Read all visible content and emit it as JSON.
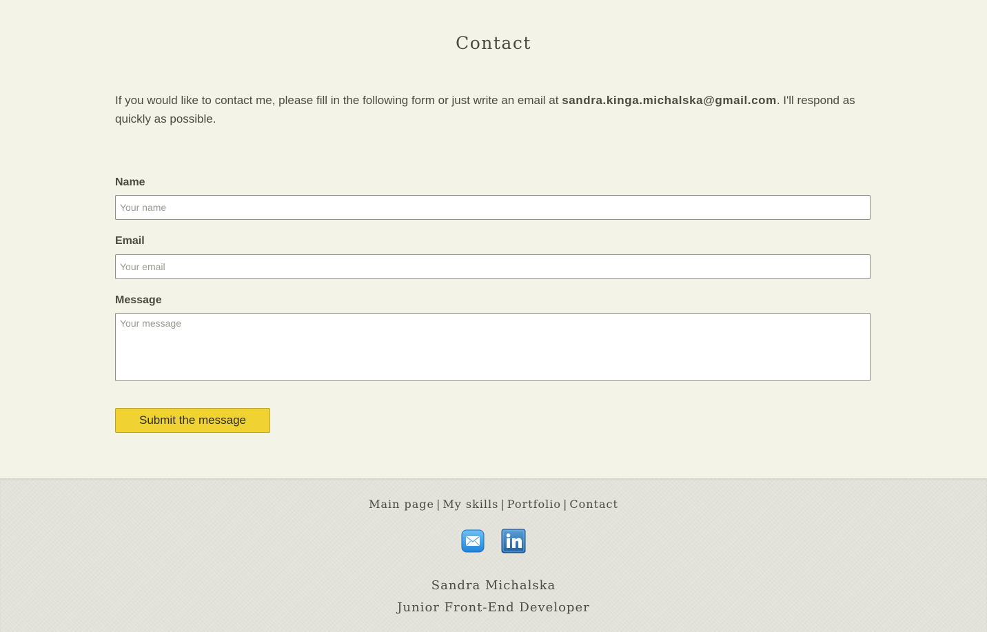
{
  "page": {
    "title": "Contact"
  },
  "intro": {
    "before": "If you would like to contact me, please fill in the following form or just write an email at ",
    "email": "sandra.kinga.michalska@gmail.com",
    "after": ". I'll respond as quickly as possible."
  },
  "form": {
    "name_label": "Name",
    "name_placeholder": "Your name",
    "email_label": "Email",
    "email_placeholder": "Your email",
    "message_label": "Message",
    "message_placeholder": "Your message",
    "submit_label": "Submit the message",
    "submit_color": "#f0d333"
  },
  "footer": {
    "nav": [
      {
        "label": "Main page"
      },
      {
        "label": "My skills"
      },
      {
        "label": "Portfolio"
      },
      {
        "label": "Contact"
      }
    ],
    "separator": "|",
    "social": [
      {
        "icon": "email-icon"
      },
      {
        "icon": "linkedin-icon"
      }
    ],
    "author_name": "Sandra Michalska",
    "author_role": "Junior Front-End Developer"
  }
}
